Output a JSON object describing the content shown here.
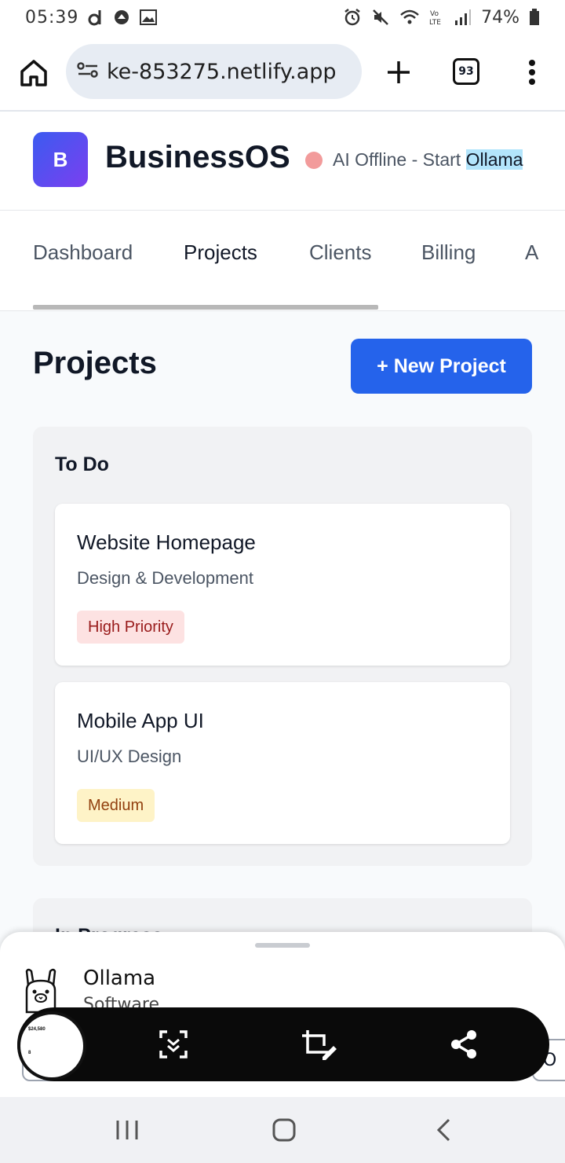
{
  "status_bar": {
    "time": "05:39",
    "battery": "74%"
  },
  "browser": {
    "url": "ke-853275.netlify.app",
    "tab_count": "93"
  },
  "app": {
    "logo_letter": "B",
    "title": "BusinessOS",
    "status_prefix": "AI Offline - Start ",
    "status_highlight": "Ollama",
    "status_color": "#f29b9b"
  },
  "nav": {
    "tabs": [
      {
        "label": "Dashboard",
        "active": false
      },
      {
        "label": "Projects",
        "active": true
      },
      {
        "label": "Clients",
        "active": false
      },
      {
        "label": "Billing",
        "active": false
      },
      {
        "label": "A",
        "active": false
      }
    ]
  },
  "main": {
    "page_title": "Projects",
    "new_button": "+ New Project",
    "columns": [
      {
        "title": "To Do",
        "cards": [
          {
            "title": "Website Homepage",
            "subtitle": "Design & Development",
            "badge": "High Priority"
          },
          {
            "title": "Mobile App UI",
            "subtitle": "UI/UX Design",
            "badge": "Medium"
          }
        ]
      },
      {
        "title": "In Progress"
      }
    ]
  },
  "sheet": {
    "app_name": "Ollama",
    "app_subtitle": "Software",
    "edge_button_label": "O"
  },
  "screenshot_toolbar": {
    "thumb_value": "$24,580",
    "thumb_value2": "8"
  },
  "colors": {
    "accent": "#2563eb",
    "logo_gradient_start": "#3b5bf0",
    "logo_gradient_end": "#7b3ff0",
    "high_badge_bg": "#fde2e2",
    "medium_badge_bg": "#fef3c7"
  }
}
